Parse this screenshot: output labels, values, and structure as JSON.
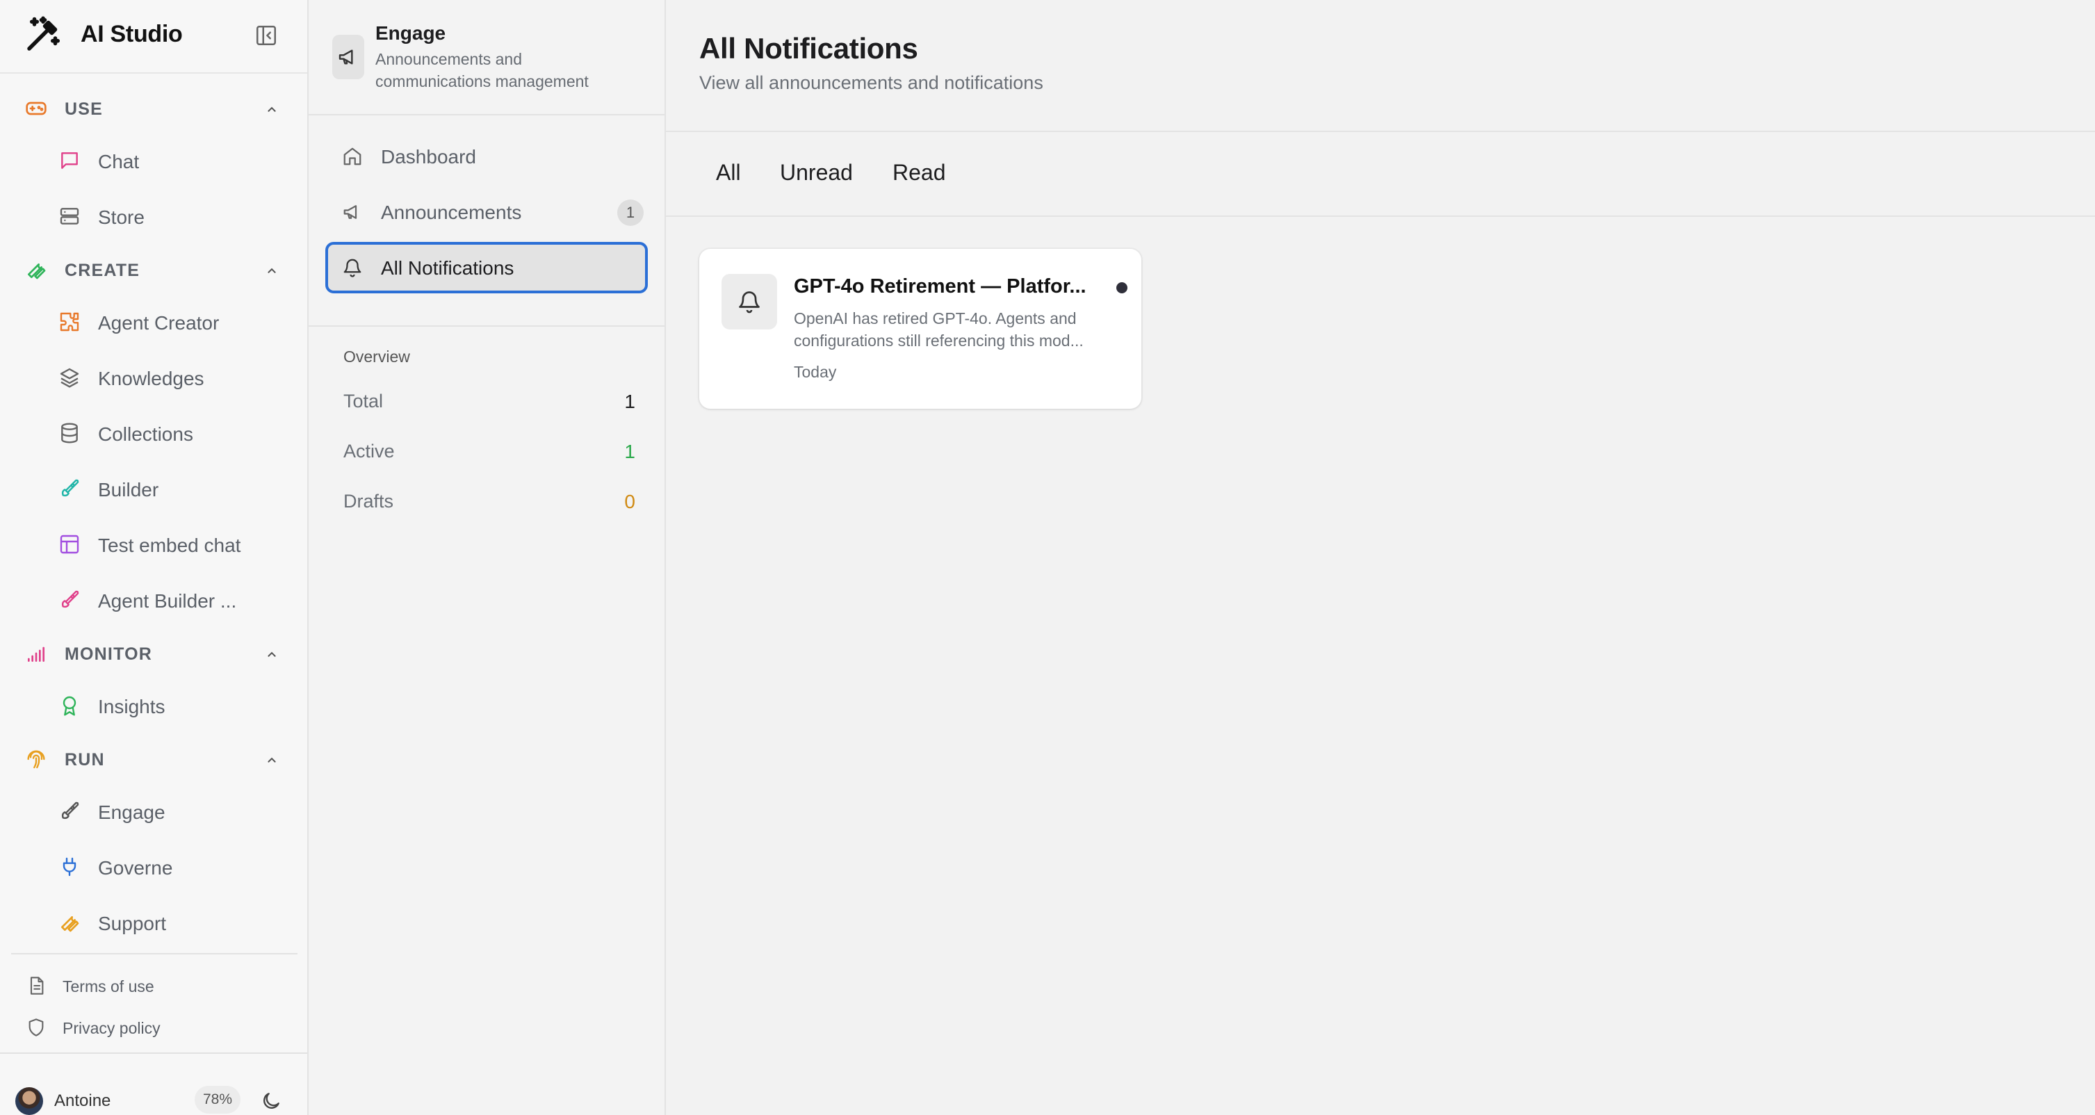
{
  "app": {
    "title": "AI Studio"
  },
  "sidebar": {
    "sections": {
      "use": {
        "label": "USE",
        "color": "#e8792b"
      },
      "create": {
        "label": "CREATE",
        "color": "#2fb45a"
      },
      "monitor": {
        "label": "MONITOR",
        "color": "#e0408a"
      },
      "run": {
        "label": "RUN",
        "color": "#e8a020"
      }
    },
    "items": {
      "chat": "Chat",
      "store": "Store",
      "agent_creator": "Agent Creator",
      "knowledges": "Knowledges",
      "collections": "Collections",
      "builder": "Builder",
      "test_embed_chat": "Test embed chat",
      "agent_builder": "Agent Builder ...",
      "insights": "Insights",
      "engage": "Engage",
      "governe": "Governe",
      "support": "Support"
    },
    "footer": {
      "terms": "Terms of use",
      "privacy": "Privacy policy"
    },
    "user": {
      "name": "Antoine",
      "badge": "78%"
    }
  },
  "engage_panel": {
    "title": "Engage",
    "subtitle": "Announcements and communications management",
    "nav": {
      "dashboard": "Dashboard",
      "announcements": "Announcements",
      "announcements_count": "1",
      "all_notifications": "All Notifications"
    },
    "overview": {
      "title": "Overview",
      "total_label": "Total",
      "total_value": "1",
      "active_label": "Active",
      "active_value": "1",
      "drafts_label": "Drafts",
      "drafts_value": "0"
    },
    "colors": {
      "active_value": "#2aa84a",
      "drafts_value": "#d08a12",
      "total_value": "#1d1d1f",
      "selected_border": "#2b6fd6"
    }
  },
  "main": {
    "title": "All Notifications",
    "subtitle": "View all announcements and notifications",
    "tabs": {
      "all": "All",
      "unread": "Unread",
      "read": "Read"
    },
    "notification": {
      "title": "GPT-4o Retirement — Platfor...",
      "body": "OpenAI has retired GPT-4o. Agents and configurations still referencing this mod...",
      "date": "Today",
      "unread": true
    }
  }
}
